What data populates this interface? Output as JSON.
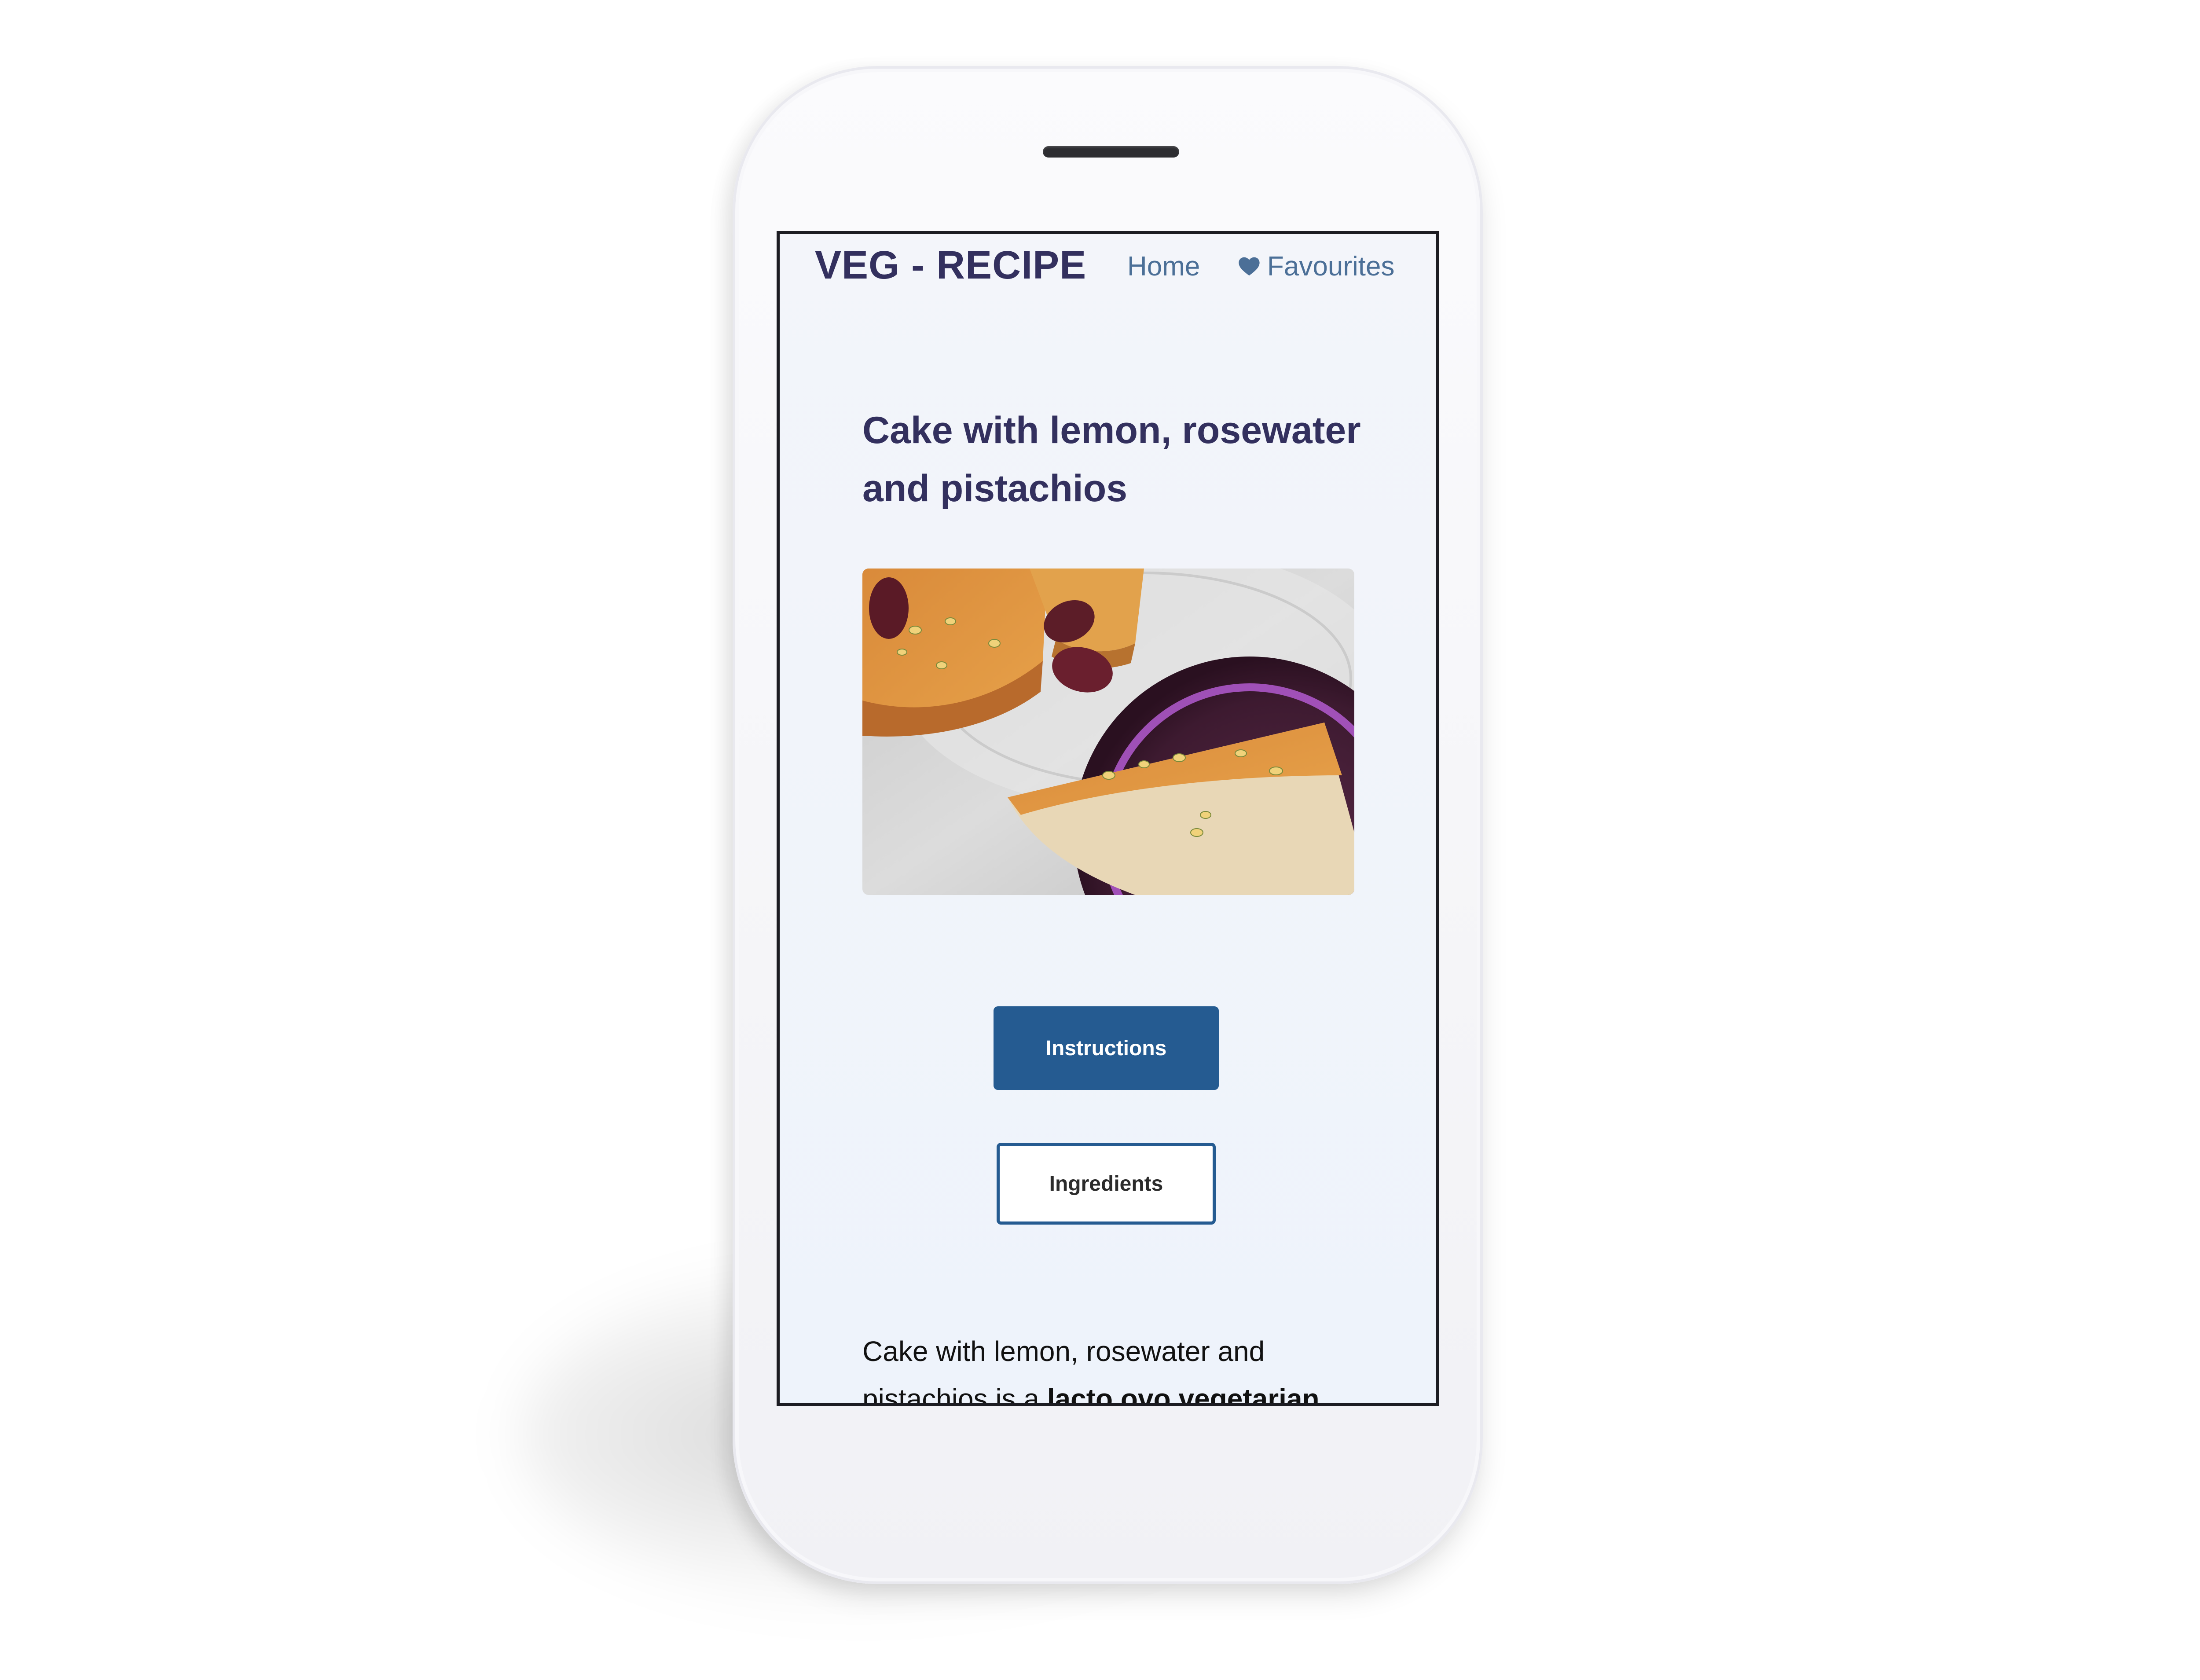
{
  "app": {
    "brand": "VEG - RECIPE"
  },
  "nav": {
    "home_label": "Home",
    "favourites_label": "Favourites",
    "favourites_icon": "heart-icon"
  },
  "recipe": {
    "title": "Cake with lemon, rosewater and pistachios",
    "image_icon": "recipe-photo",
    "description_plain": "Cake with lemon, rosewater and pistachios is a ",
    "description_bold": "lacto ovo vegetarian"
  },
  "actions": {
    "instructions_label": "Instructions",
    "ingredients_label": "Ingredients"
  },
  "colors": {
    "brand": "#33305e",
    "nav_link": "#4b6f97",
    "primary_button": "#255b91",
    "screen_bg": "#f3f5fa"
  }
}
